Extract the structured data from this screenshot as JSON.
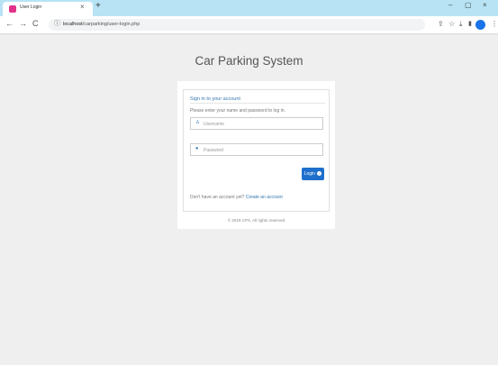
{
  "browser": {
    "tab_title": "User Login",
    "tab_close": "×",
    "new_tab": "+",
    "url_host": "localhost",
    "url_path": "/carparking/user-login.php",
    "nav": {
      "back": "←",
      "forward": "→",
      "reload": "C"
    },
    "window": {
      "minimize": "–",
      "maximize": "▢",
      "close": "×"
    },
    "accent": "#b7e3f4"
  },
  "page": {
    "title": "Car Parking System",
    "panel_heading": "Sign in to your account",
    "intro": "Please enter your name and password to log in.",
    "username": {
      "placeholder": "Username",
      "value": ""
    },
    "password": {
      "placeholder": "Password",
      "value": ""
    },
    "login_label": "Login",
    "signup_text": "Don't have an account yet?",
    "signup_link": "Create an account",
    "footer": "© 2019 CPS. All rights reserved",
    "primary_color": "#1e6fcc"
  },
  "icons": {
    "tab_favicon": "favicon-icon",
    "secure": "info-icon",
    "user": "user-icon",
    "lock": "lock-icon",
    "login": "arrow-right-circle-icon"
  }
}
